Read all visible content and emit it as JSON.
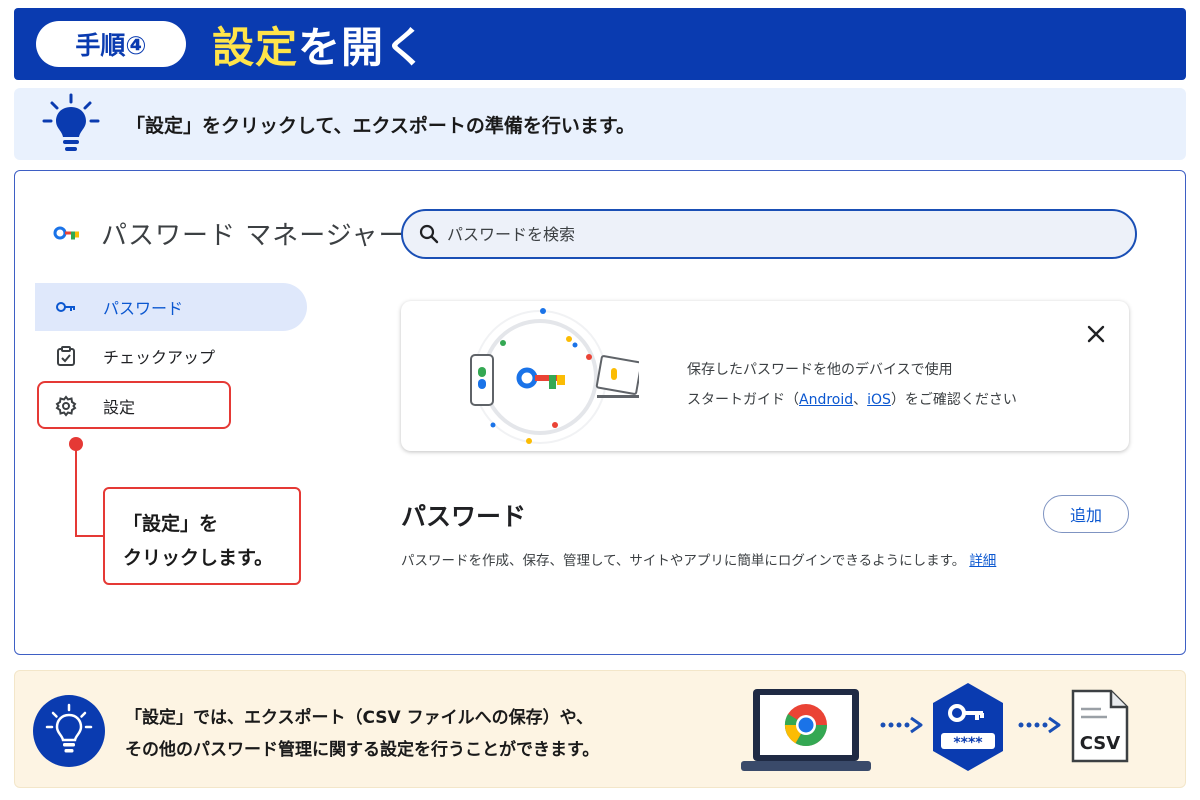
{
  "header": {
    "step_label": "手順④",
    "title_highlight": "設定",
    "title_rest": "を開く"
  },
  "instruction": {
    "text": "「設定」をクリックして、エクスポートの準備を行います。"
  },
  "app": {
    "title": "パスワード マネージャー",
    "search_placeholder": "パスワードを検索",
    "nav": [
      {
        "label": "パスワード",
        "icon": "key-icon",
        "active": true
      },
      {
        "label": "チェックアップ",
        "icon": "clipboard-check-icon",
        "active": false
      },
      {
        "label": "設定",
        "icon": "gear-icon",
        "active": false
      }
    ],
    "callout": {
      "line1": "「設定」を",
      "line2": "クリックします。"
    },
    "promo": {
      "line1": "保存したパスワードを他のデバイスで使用",
      "line2_prefix": "スタートガイド（",
      "android_link": "Android",
      "separator": "、",
      "ios_link": "iOS",
      "line2_suffix": "）をご確認ください"
    },
    "section": {
      "title": "パスワード",
      "add_label": "追加",
      "description": "パスワードを作成、保存、管理して、サイトやアプリに簡単にログインできるようにします。",
      "details_link": "詳細"
    }
  },
  "tip": {
    "line1": "「設定」では、エクスポート（CSV ファイルへの保存）や、",
    "line2": "その他のパスワード管理に関する設定を行うことができます。",
    "vault_mask": "****",
    "csv_label": "CSV"
  },
  "colors": {
    "brand_blue": "#0a3bb0",
    "highlight_yellow": "#ffe44a",
    "active_nav_bg": "#dfe8fb",
    "link_blue": "#0b57d0",
    "callout_red": "#e53935",
    "tip_bg": "#fdf4e3"
  }
}
